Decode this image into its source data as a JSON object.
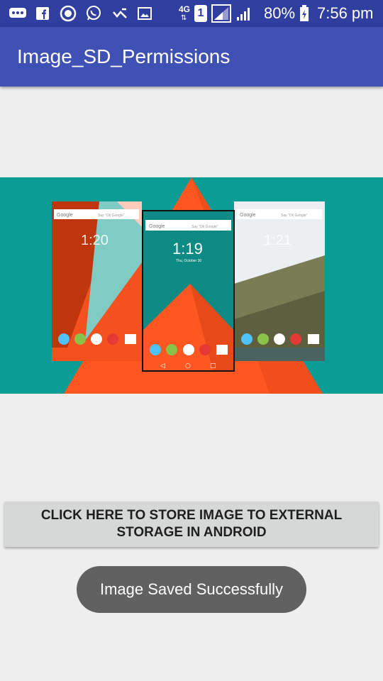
{
  "status_bar": {
    "network_label": "4G",
    "sim_label": "1",
    "battery_percent": "80%",
    "time": "7:56 pm",
    "left_icons": [
      "chat-bubble-icon",
      "facebook-icon",
      "browser-icon",
      "whatsapp-icon",
      "check-icon",
      "image-icon"
    ]
  },
  "app_bar": {
    "title": "Image_SD_Permissions",
    "color": "#3f51b5",
    "status_color": "#303f9f"
  },
  "hero_image": {
    "phones": [
      {
        "search_text": "Google",
        "hint": "Say \"Ok Google\"",
        "clock": "1:20"
      },
      {
        "search_text": "Google",
        "hint": "Say \"Ok Google\"",
        "clock": "1:19",
        "date": "Thu, October 30"
      },
      {
        "search_text": "Google",
        "hint": "Say \"Ok Google\"",
        "clock": "1:21"
      }
    ]
  },
  "actions": {
    "store_button_label": "CLICK HERE TO STORE IMAGE TO EXTERNAL STORAGE IN ANDROID"
  },
  "toast": {
    "message": "Image Saved Successfully"
  }
}
